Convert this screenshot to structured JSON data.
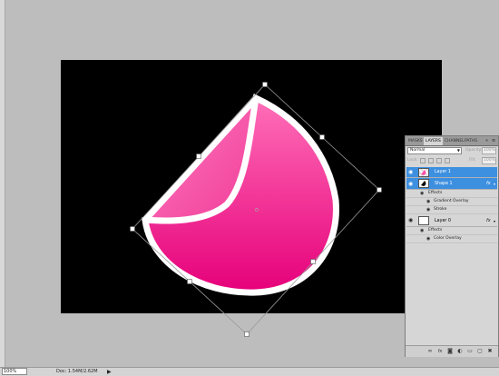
{
  "statusbar": {
    "zoom": "100%",
    "doc_info": "Doc: 1.54M/2.62M",
    "arrow": "▶"
  },
  "layers_panel": {
    "tabs": [
      {
        "label": "MASKS",
        "active": false
      },
      {
        "label": "LAYERS",
        "active": true
      },
      {
        "label": "CHANNEL",
        "active": false
      },
      {
        "label": "PATHS",
        "active": false
      }
    ],
    "collapse_icon": "«",
    "menu_icon": "≡",
    "blend_mode": "Normal",
    "opacity_label": "Opacity:",
    "opacity_value": "100%",
    "lock_label": "Lock:",
    "fill_label": "Fill:",
    "fill_value": "100%",
    "layers": [
      {
        "name": "Layer 1",
        "selected": true,
        "thumbnail": "transparent-pink"
      },
      {
        "name": "Shape 1",
        "selected": true,
        "thumbnail": "black-shape",
        "fx": "fx"
      },
      {
        "name": "Layer 0",
        "selected": false,
        "thumbnail": "white",
        "fx": "fx"
      }
    ],
    "shape1_effects": {
      "header": "Effects",
      "items": [
        "Gradient Overlay",
        "Stroke"
      ]
    },
    "layer0_effects": {
      "header": "Effects",
      "items": [
        "Color Overlay"
      ]
    },
    "bottom_icons": [
      "link-icon",
      "fx-icon",
      "mask-icon",
      "adjustment-icon",
      "folder-icon",
      "new-layer-icon",
      "trash-icon"
    ]
  },
  "colors": {
    "sticker_top": "#ff5fb0",
    "sticker_bottom": "#e8007a",
    "selection_blue": "#3d8fe0",
    "document_bg": "#000000"
  }
}
